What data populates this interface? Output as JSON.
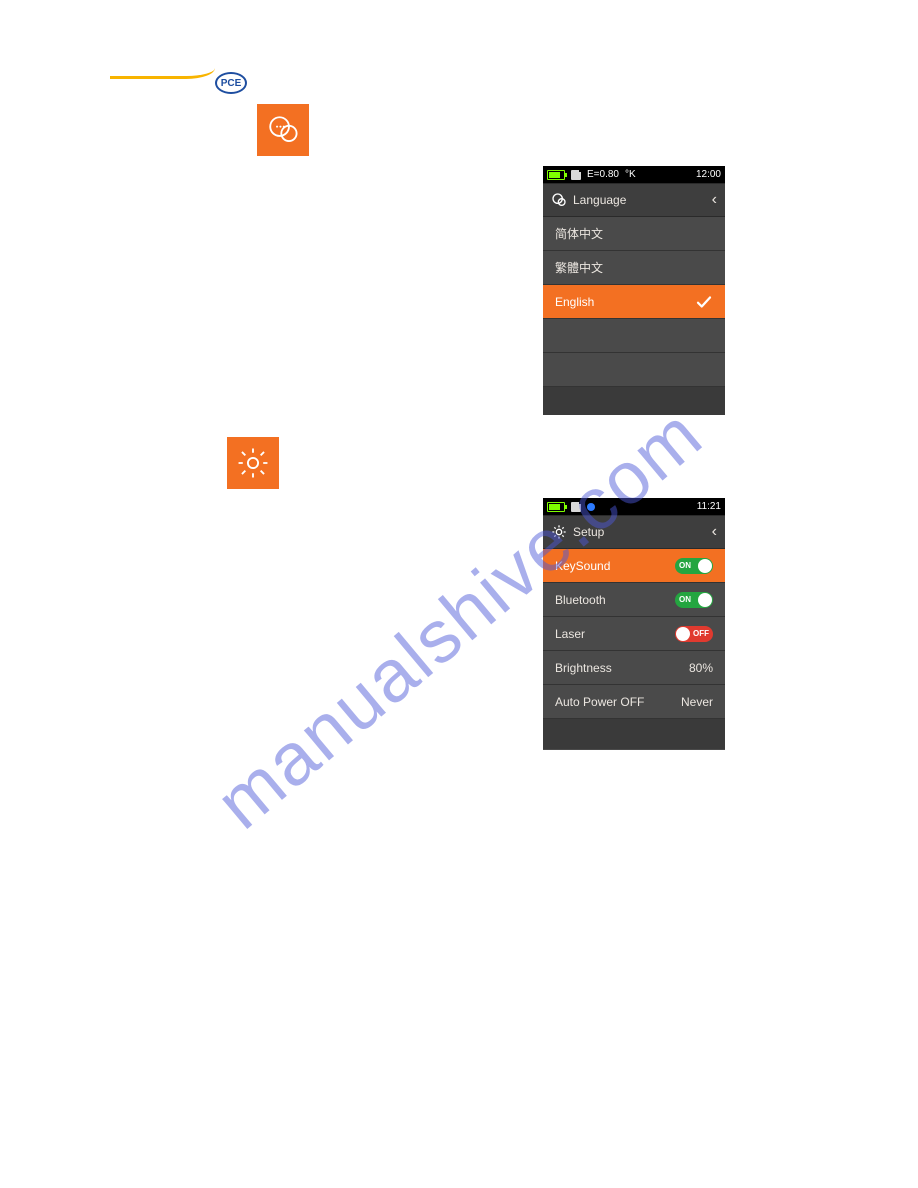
{
  "brand": {
    "label": "PCE"
  },
  "tiles": {
    "language_icon": "speech-bubble-icon",
    "setup_icon": "gear-icon"
  },
  "screen_language": {
    "statusbar": {
      "emissivity": "E=0.80",
      "unit": "°K",
      "time": "12:00"
    },
    "title": "Language",
    "items": [
      {
        "label": "简体中文",
        "selected": false
      },
      {
        "label": "繁體中文",
        "selected": false
      },
      {
        "label": "English",
        "selected": true
      }
    ]
  },
  "screen_setup": {
    "statusbar": {
      "time": "11:21"
    },
    "title": "Setup",
    "rows": {
      "keysound": {
        "label": "KeySound",
        "state": "ON",
        "selected": true
      },
      "bluetooth": {
        "label": "Bluetooth",
        "state": "ON"
      },
      "laser": {
        "label": "Laser",
        "state": "OFF"
      },
      "brightness": {
        "label": "Brightness",
        "value": "80%"
      },
      "autopoweroff": {
        "label": "Auto Power OFF",
        "value": "Never"
      }
    }
  },
  "watermark": "manualshive.com"
}
